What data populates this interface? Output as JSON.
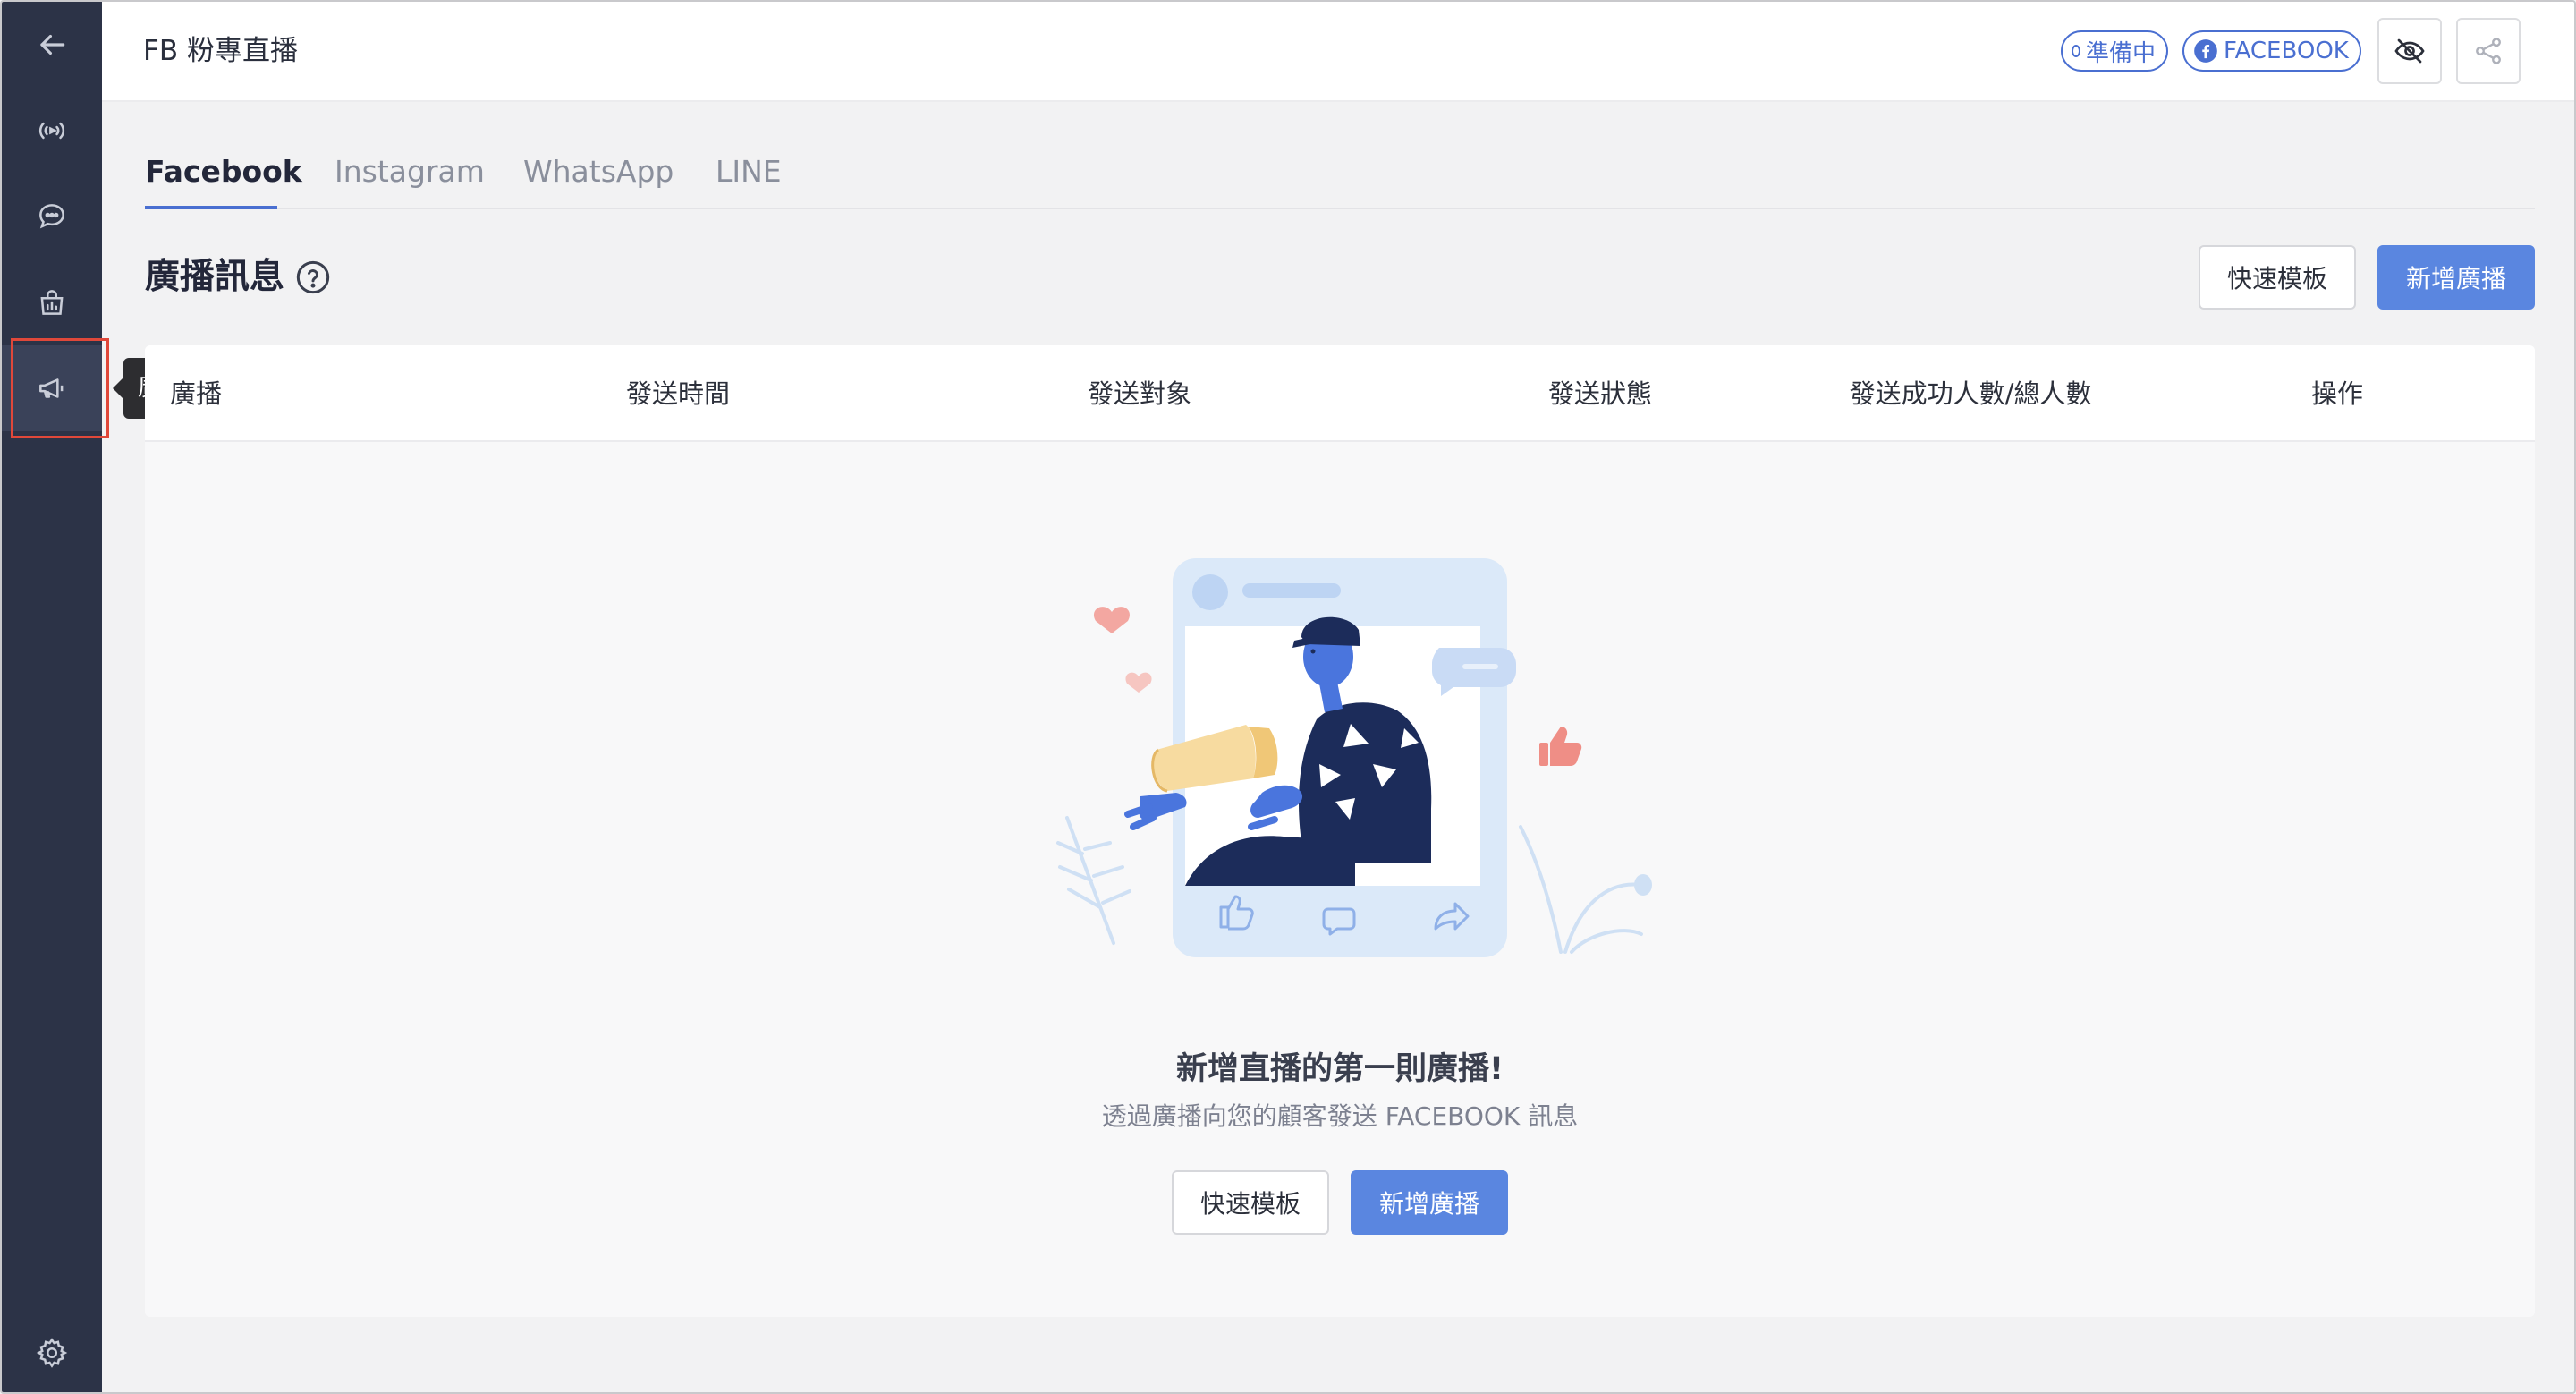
{
  "sidebar": {
    "tooltip": "廣播"
  },
  "header": {
    "title": "FB 粉專直播",
    "status_pill": "準備中",
    "platform_pill": "FACEBOOK"
  },
  "tabs": [
    {
      "label": "Facebook",
      "active": true
    },
    {
      "label": "Instagram",
      "active": false
    },
    {
      "label": "WhatsApp",
      "active": false
    },
    {
      "label": "LINE",
      "active": false
    }
  ],
  "section": {
    "title": "廣播訊息",
    "quick_template_label": "快速模板",
    "new_broadcast_label": "新增廣播"
  },
  "table": {
    "columns": [
      "廣播",
      "發送時間",
      "發送對象",
      "發送狀態",
      "發送成功人數/總人數",
      "操作"
    ]
  },
  "empty_state": {
    "title": "新增直播的第一則廣播!",
    "subtitle": "透過廣播向您的顧客發送 FACEBOOK 訊息",
    "quick_template_label": "快速模板",
    "new_broadcast_label": "新增廣播"
  },
  "colors": {
    "sidebar_bg": "#2c3347",
    "accent": "#5a86e0",
    "highlight_outline": "#e0483a"
  }
}
